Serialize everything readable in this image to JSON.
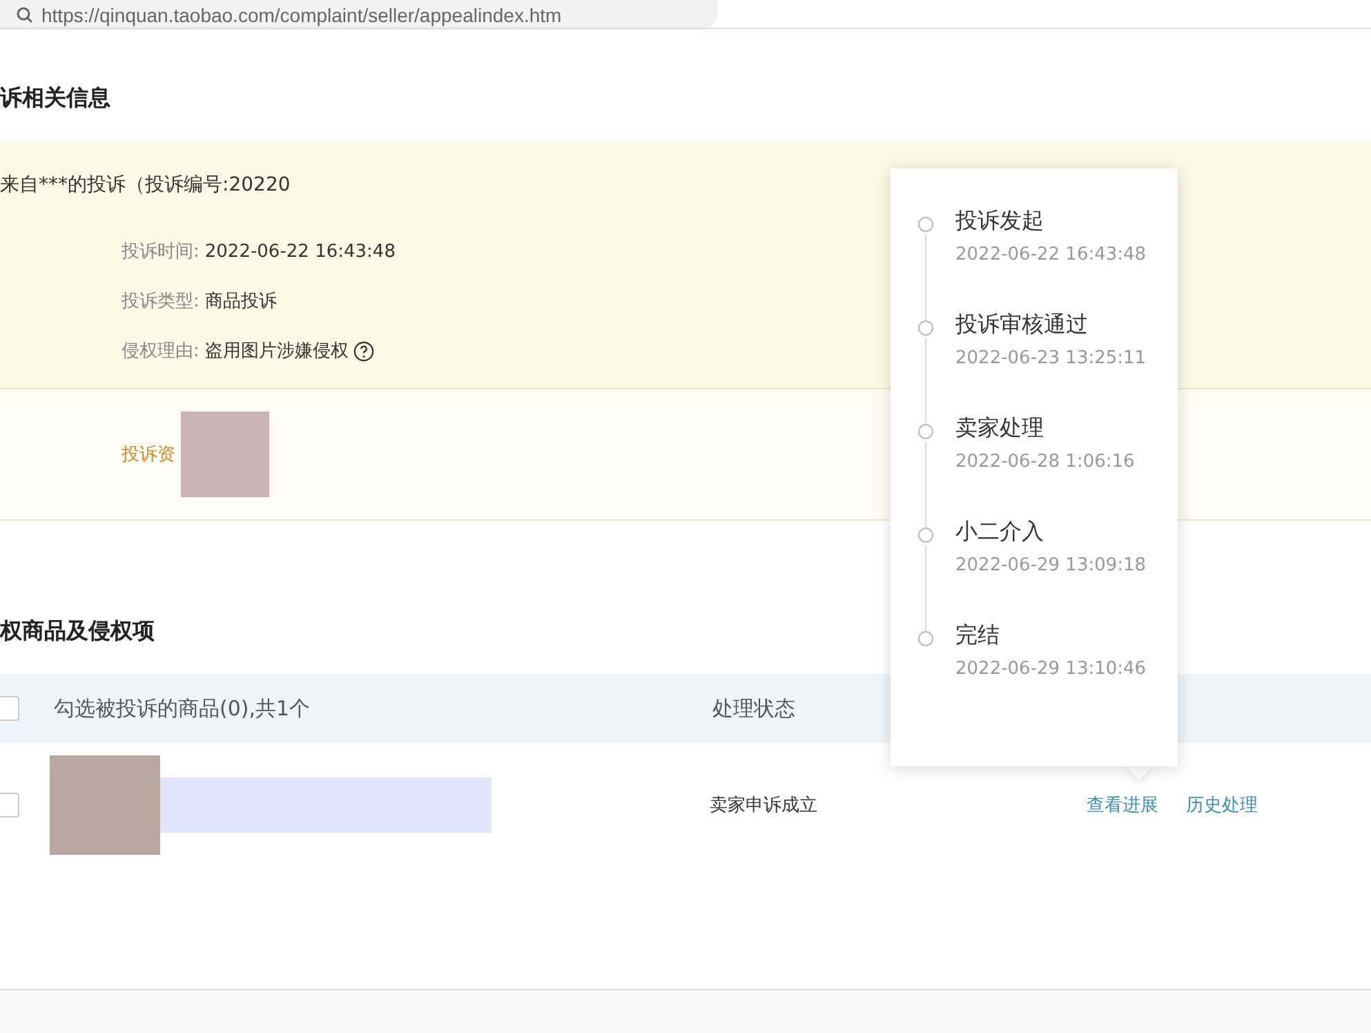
{
  "address_bar": {
    "url": "https://qinquan.taobao.com/complaint/seller/appealindex.htm"
  },
  "complaint_info": {
    "title": "诉相关信息",
    "heading": "来自***的投诉（投诉编号:20220",
    "fields": [
      {
        "label": "投诉时间:",
        "value": "2022-06-22 16:43:48",
        "help": false
      },
      {
        "label": "投诉类型:",
        "value": "商品投诉",
        "help": false
      },
      {
        "label": "侵权理由:",
        "value": "盗用图片涉嫌侵权",
        "help": true
      }
    ],
    "qualification_label": "投诉资"
  },
  "timeline": [
    {
      "label": "投诉发起",
      "time": "2022-06-22 16:43:48"
    },
    {
      "label": "投诉审核通过",
      "time": "2022-06-23 13:25:11"
    },
    {
      "label": "卖家处理",
      "time": "2022-06-28 1:06:16"
    },
    {
      "label": "小二介入",
      "time": "2022-06-29 13:09:18"
    },
    {
      "label": "完结",
      "time": "2022-06-29 13:10:46"
    }
  ],
  "goods": {
    "title": "权商品及侵权项",
    "header": {
      "checked": false,
      "select_label": "勾选被投诉的商品(0),共1个",
      "status_label": "处理状态"
    },
    "rows": [
      {
        "checked": false,
        "status": "卖家申诉成立",
        "actions": [
          "查看进展",
          "历史处理"
        ]
      }
    ]
  }
}
